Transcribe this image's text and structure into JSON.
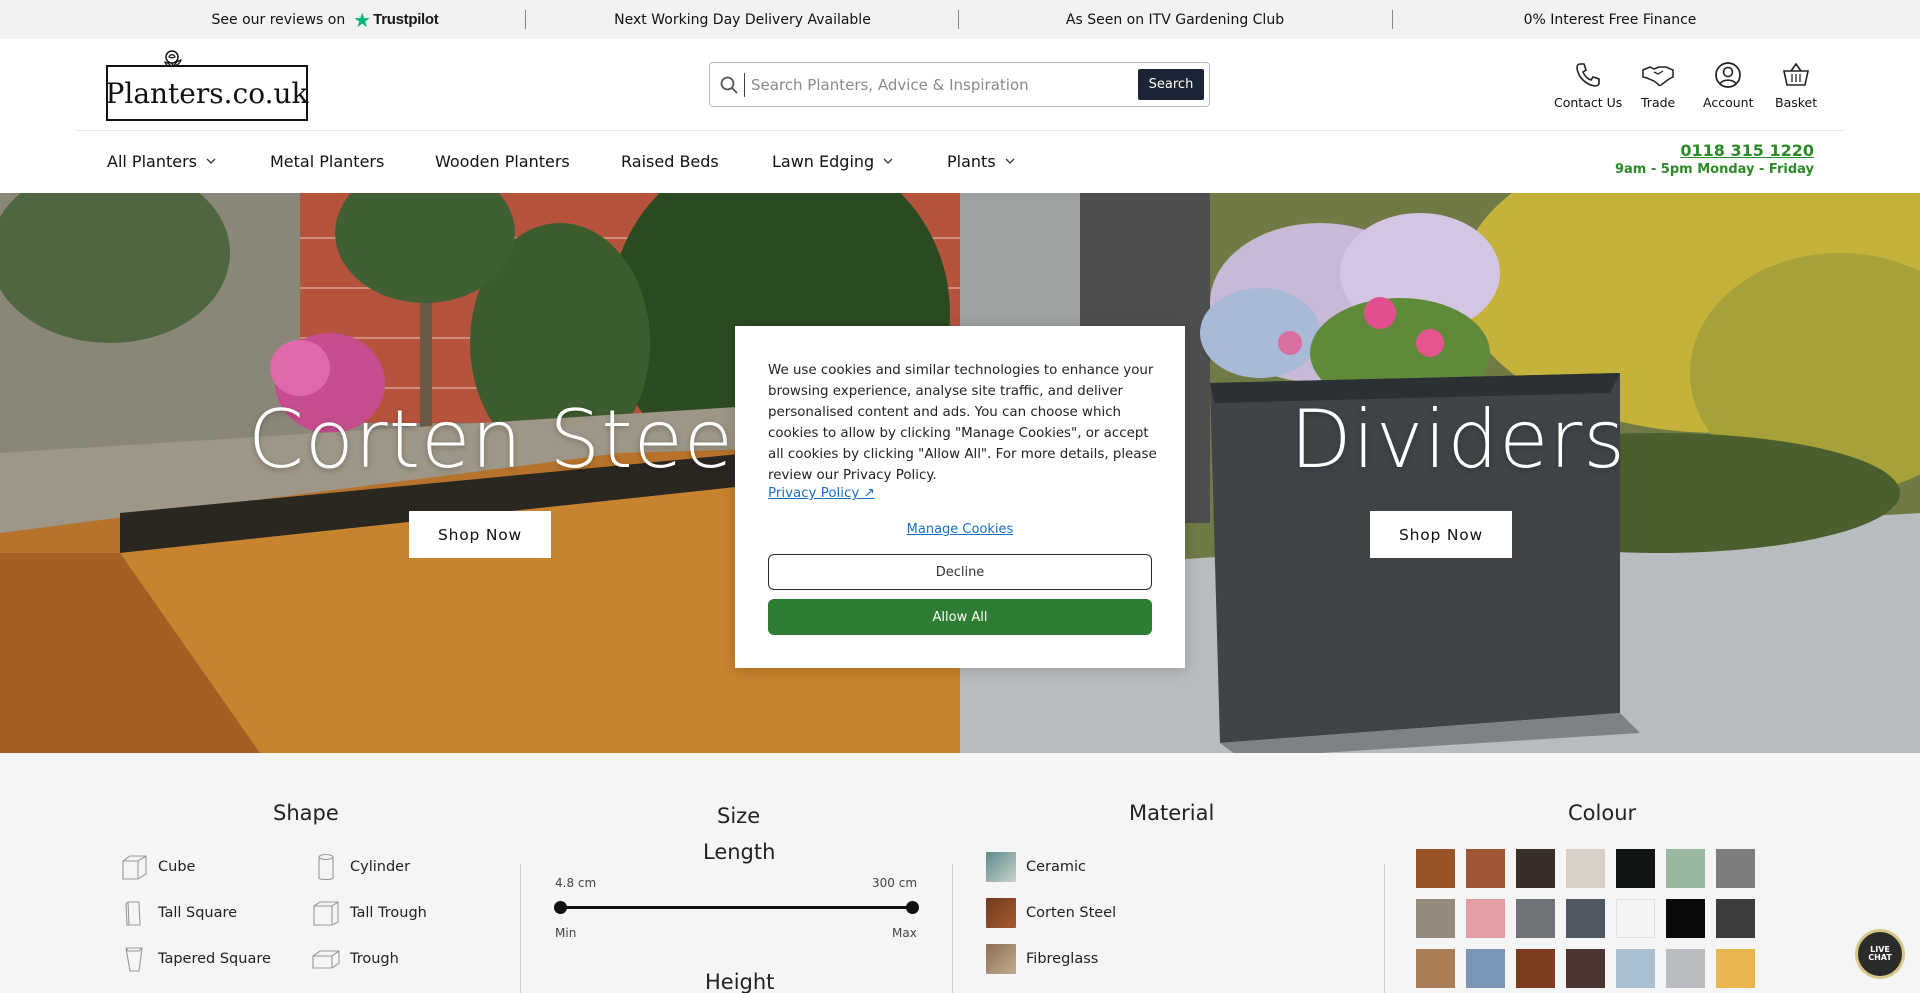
{
  "topbar": {
    "reviews_prefix": "See our reviews on",
    "reviews_brand": "Trustpilot",
    "delivery": "Next Working Day Delivery Available",
    "itv": "As Seen on ITV Gardening Club",
    "finance": "0% Interest Free Finance"
  },
  "header": {
    "logo_text": "Planters.co.uk",
    "search": {
      "placeholder": "Search Planters, Advice & Inspiration",
      "button": "Search"
    },
    "icons": {
      "contact": "Contact Us",
      "trade": "Trade",
      "account": "Account",
      "basket": "Basket"
    }
  },
  "nav": {
    "items": [
      "All Planters",
      "Metal Planters",
      "Wooden Planters",
      "Raised Beds",
      "Lawn Edging",
      "Plants"
    ],
    "phone": "0118 315 1220",
    "hours": "9am - 5pm Monday - Friday"
  },
  "hero": {
    "left": {
      "title": "Corten Steel",
      "cta": "Shop Now"
    },
    "right": {
      "title": "Dividers",
      "cta": "Shop Now"
    }
  },
  "cookie": {
    "message": "We use cookies and similar technologies to enhance your browsing experience, analyse site traffic, and deliver personalised content and ads. You can choose which cookies to allow by clicking \"Manage Cookies\", or accept all cookies by clicking \"Allow All\". For more details, please review our Privacy Policy.",
    "privacy_link": "Privacy Policy ↗",
    "manage": "Manage Cookies",
    "decline": "Decline",
    "allow": "Allow All"
  },
  "filters": {
    "shape": {
      "title": "Shape",
      "items": [
        "Cube",
        "Cylinder",
        "Tall Square",
        "Tall Trough",
        "Tapered Square",
        "Trough"
      ]
    },
    "size": {
      "title": "Size",
      "length_label": "Length",
      "min_value": "4.8 cm",
      "max_value": "300 cm",
      "min_label": "Min",
      "max_label": "Max",
      "height_label": "Height"
    },
    "material": {
      "title": "Material",
      "items": [
        "Ceramic",
        "Corten Steel",
        "Fibreglass"
      ]
    },
    "colour": {
      "title": "Colour",
      "swatches": [
        "#9a5329",
        "#9f5536",
        "#3a2e2a",
        "#d8cfc6",
        "#111516",
        "#9bb79f",
        "#7d7d7f",
        "#968a7c",
        "#e39ea3",
        "#6f7276",
        "#4f5860",
        "#f4f4f4",
        "#0a0a0a",
        "#3c3c3c",
        "#a97d55",
        "#7a97ba",
        "#7d3c20",
        "#4b3530",
        "#a9c0d2",
        "#b8bcc0",
        "#e9b54e"
      ]
    }
  },
  "live_chat": "LIVE CHAT"
}
